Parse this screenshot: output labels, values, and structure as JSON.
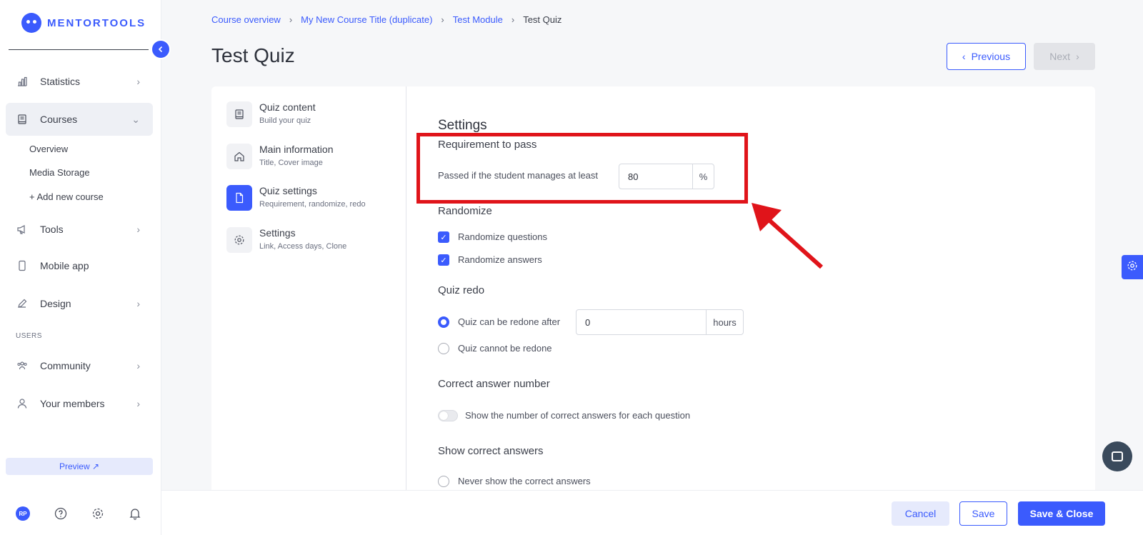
{
  "logo": {
    "text": "MENTORTOOLS"
  },
  "sidebar": {
    "nav": [
      {
        "label": "Statistics",
        "icon": "bar-chart-icon"
      },
      {
        "label": "Courses",
        "icon": "book-icon"
      },
      {
        "label": "Tools",
        "icon": "megaphone-icon"
      },
      {
        "label": "Mobile app",
        "icon": "phone-icon"
      },
      {
        "label": "Design",
        "icon": "pen-icon"
      },
      {
        "label": "Community",
        "icon": "people-icon"
      },
      {
        "label": "Your members",
        "icon": "user-icon"
      }
    ],
    "courses_sub": [
      "Overview",
      "Media Storage",
      "+ Add new course"
    ],
    "users_label": "USERS",
    "preview_label": "Preview ↗",
    "avatar_initials": "RP"
  },
  "breadcrumb": [
    "Course overview",
    "My New Course Title (duplicate)",
    "Test Module",
    "Test Quiz"
  ],
  "page_title": "Test Quiz",
  "nav_buttons": {
    "previous": "Previous",
    "next": "Next"
  },
  "steps": [
    {
      "title": "Quiz content",
      "sub": "Build your quiz",
      "icon": "book-icon"
    },
    {
      "title": "Main information",
      "sub": "Title, Cover image",
      "icon": "home-icon"
    },
    {
      "title": "Quiz settings",
      "sub": "Requirement, randomize, redo",
      "icon": "document-icon"
    },
    {
      "title": "Settings",
      "sub": "Link, Access days, Clone",
      "icon": "gear-icon"
    }
  ],
  "settings": {
    "heading": "Settings",
    "requirement": {
      "heading": "Requirement to pass",
      "label": "Passed if the student manages at least",
      "value": "80",
      "unit": "%"
    },
    "randomize": {
      "heading": "Randomize",
      "questions_label": "Randomize questions",
      "answers_label": "Randomize answers",
      "questions_checked": true,
      "answers_checked": true
    },
    "redo": {
      "heading": "Quiz redo",
      "option_can": "Quiz can be redone after",
      "option_cannot": "Quiz cannot be redone",
      "hours_value": "0",
      "hours_unit": "hours",
      "selected": "can"
    },
    "correct_number": {
      "heading": "Correct answer number",
      "toggle_label": "Show the number of correct answers for each question",
      "enabled": false
    },
    "show_correct": {
      "heading": "Show correct answers",
      "option_never": "Never show the correct answers"
    }
  },
  "footer": {
    "cancel": "Cancel",
    "save": "Save",
    "save_close": "Save & Close"
  },
  "colors": {
    "accent": "#3b5bfd",
    "annotation": "#e0141a"
  }
}
